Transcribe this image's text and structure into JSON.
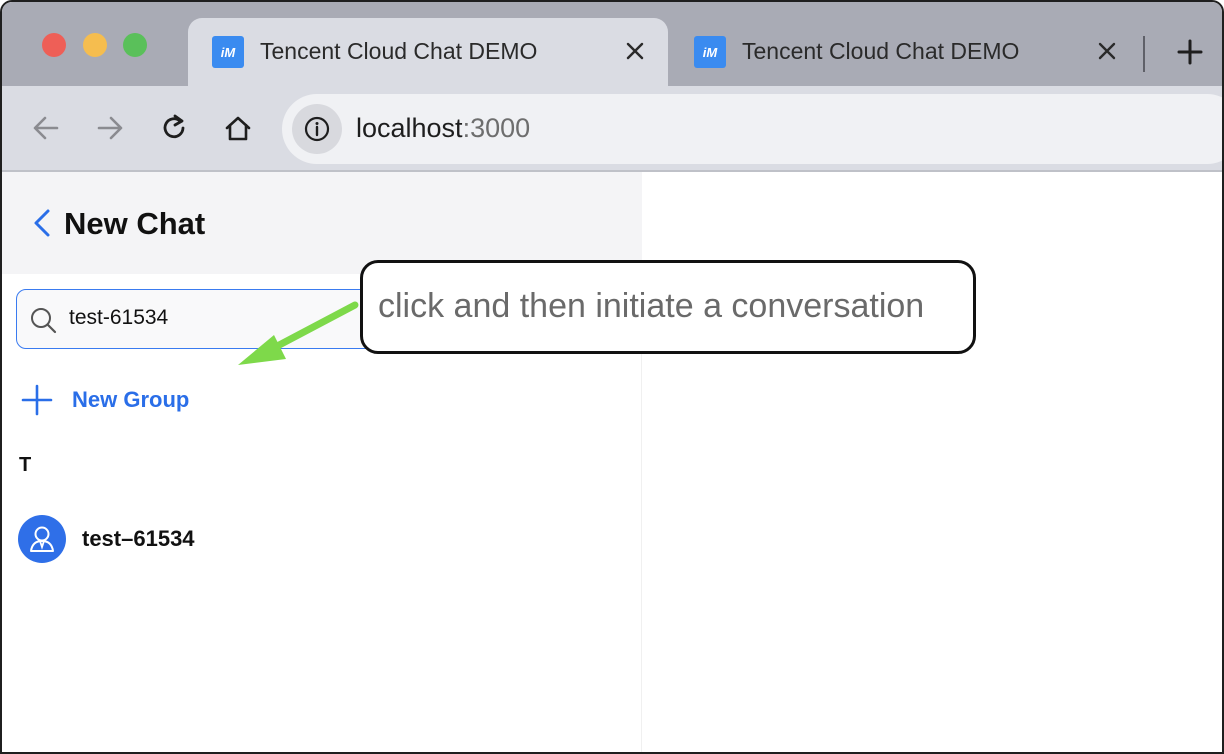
{
  "browser": {
    "tabs": [
      {
        "title": "Tencent Cloud Chat DEMO",
        "favicon": "im-logo-icon",
        "active": true
      },
      {
        "title": "Tencent Cloud Chat DEMO",
        "favicon": "im-logo-icon",
        "active": false
      }
    ],
    "favicon_text": "iM",
    "url_host": "localhost",
    "url_port": ":3000"
  },
  "panel": {
    "title": "New Chat",
    "search": {
      "value": "test-61534"
    },
    "new_group_label": "New Group",
    "section_letter": "T",
    "contacts": [
      {
        "name": "test–61534"
      }
    ]
  },
  "annotation": {
    "text": "click and then initiate a conversation"
  },
  "colors": {
    "accent": "#2a6ee8",
    "arrow": "#7ed94a"
  }
}
